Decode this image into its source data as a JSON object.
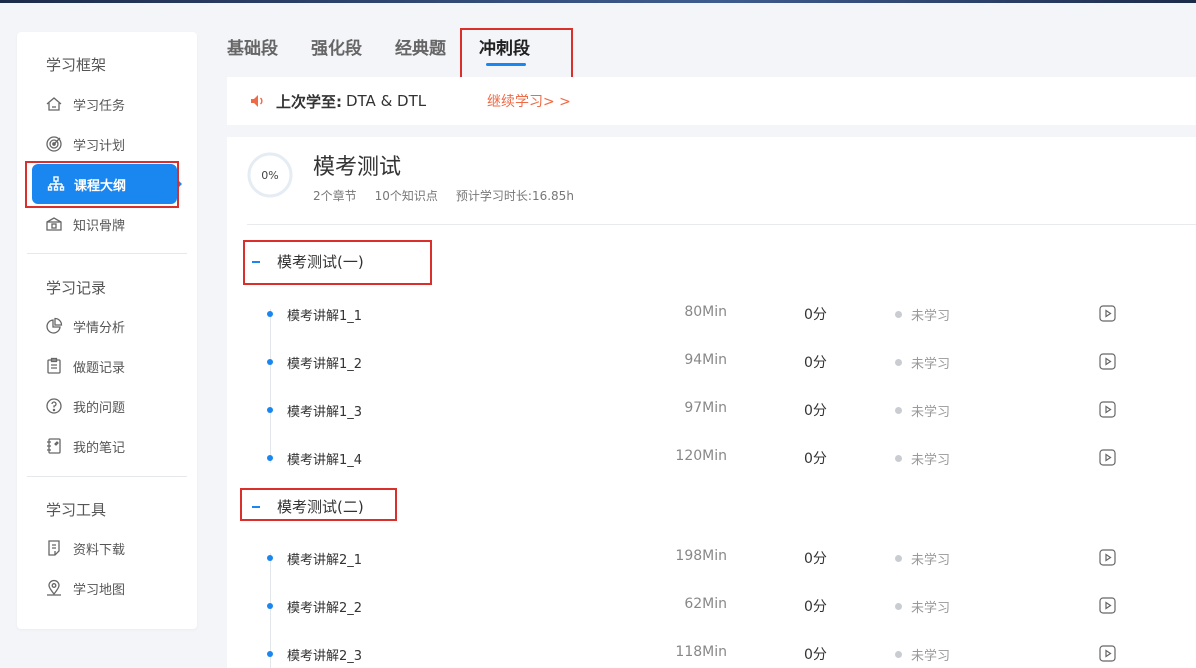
{
  "tabs": [
    "基础段",
    "强化段",
    "经典题",
    "冲刺段"
  ],
  "active_tab": "冲刺段",
  "sidebar": {
    "sections": [
      {
        "title": "学习框架",
        "items": [
          {
            "label": "学习任务",
            "icon": "home-icon"
          },
          {
            "label": "学习计划",
            "icon": "target-icon"
          },
          {
            "label": "课程大纲",
            "icon": "org-chart-icon",
            "active": true
          },
          {
            "label": "知识骨牌",
            "icon": "box-icon"
          }
        ]
      },
      {
        "title": "学习记录",
        "items": [
          {
            "label": "学情分析",
            "icon": "pie-chart-icon"
          },
          {
            "label": "做题记录",
            "icon": "clipboard-icon"
          },
          {
            "label": "我的问题",
            "icon": "question-icon"
          },
          {
            "label": "我的笔记",
            "icon": "notebook-icon"
          }
        ]
      },
      {
        "title": "学习工具",
        "items": [
          {
            "label": "资料下载",
            "icon": "download-doc-icon"
          },
          {
            "label": "学习地图",
            "icon": "map-pin-icon"
          }
        ]
      }
    ]
  },
  "last_study": {
    "label": "上次学至:",
    "value": "DTA & DTL",
    "continue_label": "继续学习> >"
  },
  "course": {
    "progress_text": "0%",
    "progress": 0,
    "title": "模考测试",
    "chapters_count": "2个章节",
    "points_count": "10个知识点",
    "duration": "预计学习时长:16.85h"
  },
  "chapters": [
    {
      "title": "模考测试(一)",
      "lessons": [
        {
          "name": "模考讲解1_1",
          "duration": "80Min",
          "score": "0分",
          "status": "未学习"
        },
        {
          "name": "模考讲解1_2",
          "duration": "94Min",
          "score": "0分",
          "status": "未学习"
        },
        {
          "name": "模考讲解1_3",
          "duration": "97Min",
          "score": "0分",
          "status": "未学习"
        },
        {
          "name": "模考讲解1_4",
          "duration": "120Min",
          "score": "0分",
          "status": "未学习"
        }
      ]
    },
    {
      "title": "模考测试(二)",
      "lessons": [
        {
          "name": "模考讲解2_1",
          "duration": "198Min",
          "score": "0分",
          "status": "未学习"
        },
        {
          "name": "模考讲解2_2",
          "duration": "62Min",
          "score": "0分",
          "status": "未学习"
        },
        {
          "name": "模考讲解2_3",
          "duration": "118Min",
          "score": "0分",
          "status": "未学习"
        }
      ]
    }
  ],
  "colors": {
    "accent": "#1a86f0",
    "continue": "#ef6a45",
    "highlight_box": "#d9302b"
  }
}
